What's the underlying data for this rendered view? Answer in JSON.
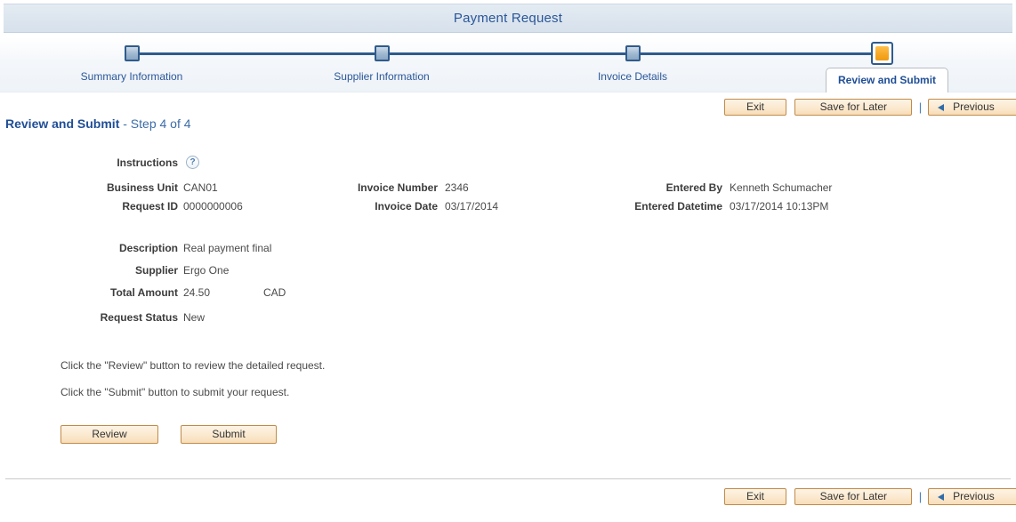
{
  "window": {
    "title": "Payment Request"
  },
  "train": {
    "steps": [
      {
        "label": "Summary Information",
        "state": "complete"
      },
      {
        "label": "Supplier Information",
        "state": "complete"
      },
      {
        "label": "Invoice Details",
        "state": "complete"
      },
      {
        "label": "Review and Submit",
        "state": "active"
      }
    ]
  },
  "toolbar": {
    "exit_label": "Exit",
    "save_label": "Save for Later",
    "previous_label": "Previous",
    "separator": "|"
  },
  "heading": {
    "title": "Review and Submit",
    "step_text": "- Step 4 of 4"
  },
  "form": {
    "instructions_label": "Instructions",
    "help_icon": "?",
    "left_column": [
      {
        "label": "Business Unit",
        "value": "CAN01"
      },
      {
        "label": "Request ID",
        "value": "0000000006"
      }
    ],
    "middle_column": [
      {
        "label": "Invoice Number",
        "value": "2346"
      },
      {
        "label": "Invoice Date",
        "value": "03/17/2014"
      }
    ],
    "right_column": [
      {
        "label": "Entered By",
        "value": "Kenneth Schumacher"
      },
      {
        "label": "Entered Datetime",
        "value": "03/17/2014 10:13PM"
      }
    ],
    "detail_rows": [
      {
        "label": "Description",
        "value": "Real payment final"
      },
      {
        "label": "Supplier",
        "value": "Ergo One"
      },
      {
        "label": "Total Amount",
        "value": "24.50",
        "extra": "CAD"
      },
      {
        "label": "Request Status",
        "value": "New"
      }
    ]
  },
  "instructions": {
    "line1": "Click the \"Review\" button to review the detailed request.",
    "line2": "Click the \"Submit\" button to submit your request."
  },
  "actions": {
    "review_label": "Review",
    "submit_label": "Submit"
  },
  "colors": {
    "title_bar": "#dde6ef",
    "title_text": "#2a5699",
    "train_line": "#2f5b8c",
    "active_marker": "#f5a623",
    "button_face": "#fbe9cf",
    "button_border": "#c08b4a",
    "link_blue": "#2a5699"
  }
}
